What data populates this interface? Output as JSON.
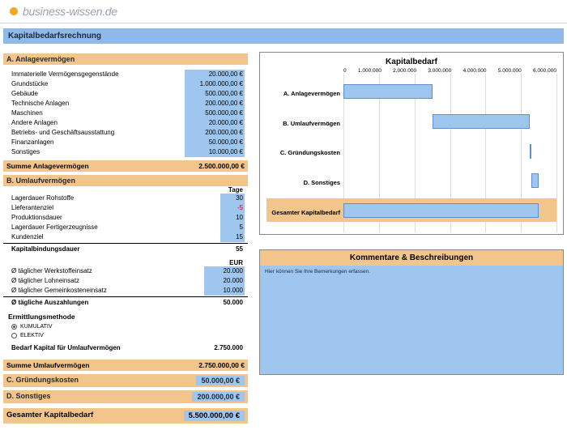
{
  "brand": "business-wissen.de",
  "title": "Kapitalbedarfsrechnung",
  "sectionA": {
    "head": "A. Anlagevermögen",
    "items": [
      {
        "label": "Immaterielle Vermögensgegenstände",
        "value": "20.000,00 €"
      },
      {
        "label": "Grundstücke",
        "value": "1.000.000,00 €"
      },
      {
        "label": "Gebäude",
        "value": "500.000,00 €"
      },
      {
        "label": "Technische Anlagen",
        "value": "200.000,00 €"
      },
      {
        "label": "Maschinen",
        "value": "500.000,00 €"
      },
      {
        "label": "Andere Anlagen",
        "value": "20.000,00 €"
      },
      {
        "label": "Betriebs- und Geschäftsausstattung",
        "value": "200.000,00 €"
      },
      {
        "label": "Finanzanlagen",
        "value": "50.000,00 €"
      },
      {
        "label": "Sonstiges",
        "value": "10.000,00 €"
      }
    ],
    "sumLabel": "Summe Anlagevermögen",
    "sumValue": "2.500.000,00 €"
  },
  "sectionB": {
    "head": "B. Umlaufvermögen",
    "daysHead": "Tage",
    "days": [
      {
        "label": "Lagerdauer Rohstoffe",
        "value": "30"
      },
      {
        "label": "Lieferantenziel",
        "value": "-5"
      },
      {
        "label": "Produktionsdauer",
        "value": "10"
      },
      {
        "label": "Lagerdauer Fertigerzeugnisse",
        "value": "5"
      },
      {
        "label": "Kundenziel",
        "value": "15"
      }
    ],
    "kbdLabel": "Kapitalbindungsdauer",
    "kbdValue": "55",
    "eurHead": "EUR",
    "eur": [
      {
        "label": "Ø täglicher Werkstoffeinsatz",
        "value": "20.000"
      },
      {
        "label": "Ø täglicher Lohneinsatz",
        "value": "20.000"
      },
      {
        "label": "Ø täglicher Gemeinkosteneinsatz",
        "value": "10.000"
      }
    ],
    "auszLabel": "Ø tägliche Auszahlungen",
    "auszValue": "50.000",
    "methodHead": "Ermittlungsmethode",
    "method1": "KUMULATIV",
    "method2": "ELEKTIV",
    "bedarfLabel": "Bedarf Kapital für Umlaufvermögen",
    "bedarfValue": "2.750.000",
    "sumLabel": "Summe Umlaufvermögen",
    "sumValue": "2.750.000,00 €"
  },
  "sectionC": {
    "head": "C. Gründungskosten",
    "value": "50.000,00 €"
  },
  "sectionD": {
    "head": "D. Sonstiges",
    "value": "200.000,00 €"
  },
  "grand": {
    "label": "Gesamter Kapitalbedarf",
    "value": "5.500.000,00 €"
  },
  "chart": {
    "title": "Kapitalbedarf",
    "ticks": [
      "0",
      "1.000.000",
      "2.000.000",
      "3.000.000",
      "4.000.000",
      "5.000.000",
      "6.000.000"
    ],
    "rows": [
      {
        "label": "A. Anlagevermögen"
      },
      {
        "label": "B. Umlaufvermögen"
      },
      {
        "label": "C. Gründungskosten"
      },
      {
        "label": "D. Sonstiges"
      },
      {
        "label": "Gesamter Kapitalbedarf"
      }
    ]
  },
  "chart_data": {
    "type": "bar",
    "title": "Kapitalbedarf",
    "orientation": "horizontal",
    "xlim": [
      0,
      6000000
    ],
    "note": "Bars appear as stacked/floating segments: A starts at 0 (width 2.5M); B starts at end of A (2.5M→5.25M, width 2.75M); C starts at end of B (5.25M→5.3M, width 0.05M); D starts at end of C (5.3M→5.5M, width 0.2M); Gesamter Kapitalbedarf spans 0→5.5M.",
    "series": [
      {
        "name": "A. Anlagevermögen",
        "start": 0,
        "end": 2500000
      },
      {
        "name": "B. Umlaufvermögen",
        "start": 2500000,
        "end": 5250000
      },
      {
        "name": "C. Gründungskosten",
        "start": 5250000,
        "end": 5300000
      },
      {
        "name": "D. Sonstiges",
        "start": 5300000,
        "end": 5500000
      },
      {
        "name": "Gesamter Kapitalbedarf",
        "start": 0,
        "end": 5500000
      }
    ]
  },
  "comments": {
    "head": "Kommentare & Beschreibungen",
    "placeholder": "Hier können Sie Ihre Bemerkungen erfassen."
  }
}
